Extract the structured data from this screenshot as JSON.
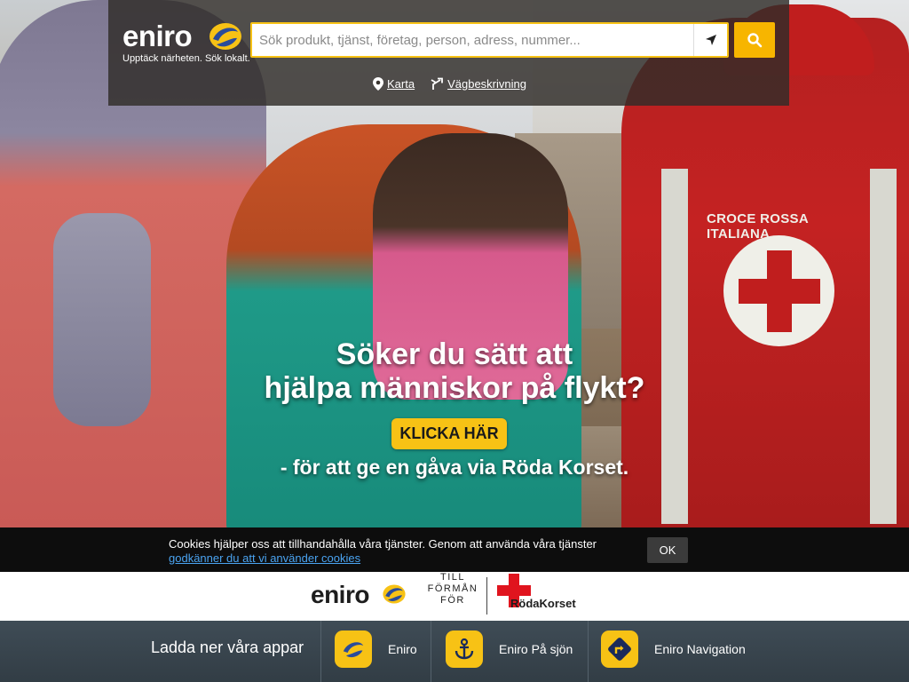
{
  "header": {
    "logo_text": "eniro",
    "tagline": "Upptäck närheten. Sök lokalt.",
    "search_placeholder": "Sök produkt, tjänst, företag, person, adress, nummer...",
    "links": [
      {
        "label": "Karta",
        "icon": "map-pin-icon"
      },
      {
        "label": "Vägbeskrivning",
        "icon": "directions-icon"
      }
    ]
  },
  "hero": {
    "title_line1": "Söker du sätt att",
    "title_line2": "hjälpa människor på flykt?",
    "cta_label": "KLICKA HÄR",
    "subtitle": "- för att ge en gåva via Röda Korset.",
    "vest_text": "CROCE ROSSA ITALIANA"
  },
  "cookie": {
    "text": "Cookies hjälper oss att tillhandahålla våra tjänster. Genom att använda våra tjänster",
    "link": "godkänner du att vi använder cookies",
    "ok_label": "OK"
  },
  "partner": {
    "logo_text": "eniro",
    "till_line1": "TILL",
    "till_line2": "FÖRMÅN",
    "till_line3": "FÖR",
    "rc_text": "RödaKorset"
  },
  "apps": {
    "title": "Ladda ner våra appar",
    "items": [
      {
        "label": "Eniro",
        "icon": "eniro-app-icon"
      },
      {
        "label": "Eniro På sjön",
        "icon": "anchor-icon"
      },
      {
        "label": "Eniro Navigation",
        "icon": "navigation-arrow-icon"
      }
    ]
  },
  "colors": {
    "accent": "#f7c215",
    "cookie_link": "#4aa3f0",
    "red_cross": "#e0141e"
  }
}
